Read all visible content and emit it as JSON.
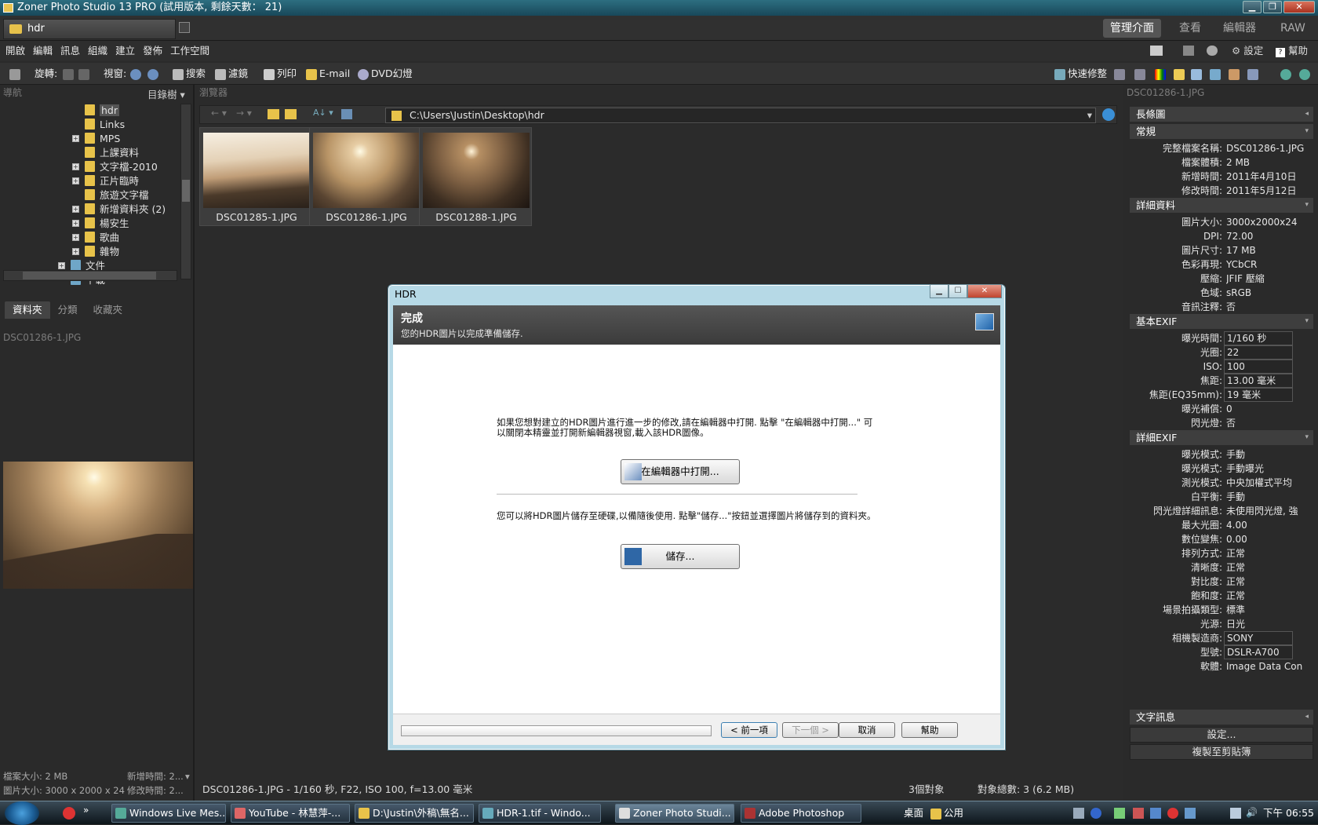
{
  "window": {
    "title": "Zoner Photo Studio 13 PRO (試用版本, 剩餘天數： 21)"
  },
  "doc_tab": "hdr",
  "modes": [
    "管理介面",
    "查看",
    "編輯器",
    "RAW"
  ],
  "menu": [
    "開啟",
    "編輯",
    "訊息",
    "組織",
    "建立",
    "發佈",
    "工作空間"
  ],
  "menu_right": {
    "settings": "設定",
    "help": "幫助"
  },
  "toolbar": {
    "rotate": "旋轉:",
    "view": "視窗:",
    "search": "搜索",
    "filter": "濾鏡",
    "print": "列印",
    "email": "E-mail",
    "dvd": "DVD幻燈",
    "quick_fix": "快速修整"
  },
  "left": {
    "nav_title": "導航",
    "tree_mode": "目錄樹",
    "tabs": [
      "資料夾",
      "分類",
      "收藏夾"
    ],
    "preview_title": "DSC01286-1.JPG",
    "tree": [
      {
        "label": "hdr",
        "plus": false,
        "selected": true
      },
      {
        "label": "Links",
        "plus": false
      },
      {
        "label": "MPS",
        "plus": true
      },
      {
        "label": "上課資料",
        "plus": false
      },
      {
        "label": "文字檔-2010",
        "plus": true
      },
      {
        "label": "正片臨時",
        "plus": true
      },
      {
        "label": "旅遊文字檔",
        "plus": false
      },
      {
        "label": "新增資料夾 (2)",
        "plus": true
      },
      {
        "label": "楊安生",
        "plus": true
      },
      {
        "label": "歌曲",
        "plus": true
      },
      {
        "label": "雜物",
        "plus": true
      },
      {
        "label": "文件",
        "plus": true,
        "level": 0
      },
      {
        "label": "下載",
        "plus": false,
        "level": 0
      }
    ],
    "status": [
      "檔案大小: 2 MB",
      "新增時間: 2...",
      "圖片大小: 3000 x 2000 x 24",
      "修改時間: 2..."
    ]
  },
  "center": {
    "title": "瀏覽器",
    "path": "C:\\Users\\Justin\\Desktop\\hdr",
    "thumbs": [
      "DSC01285-1.JPG",
      "DSC01286-1.JPG",
      "DSC01288-1.JPG"
    ],
    "status_left": "DSC01286-1.JPG - 1/160 秒, F22, ISO 100, f=13.00 毫米",
    "status_count": "3個對象",
    "status_total": "對象總數: 3 (6.2 MB)"
  },
  "right": {
    "title": "DSC01286-1.JPG",
    "sections": {
      "long": "長條圖",
      "general": "常規",
      "details": "詳細資料",
      "basic_exif": "基本EXIF",
      "detail_exif": "詳細EXIF",
      "text_info": "文字訊息"
    },
    "general": [
      [
        "完整檔案名稱:",
        "DSC01286-1.JPG"
      ],
      [
        "檔案體積:",
        "2 MB"
      ],
      [
        "新增時間:",
        "2011年4月10日"
      ],
      [
        "修改時間:",
        "2011年5月12日"
      ]
    ],
    "details": [
      [
        "圖片大小:",
        "3000x2000x24"
      ],
      [
        "DPI:",
        "72.00"
      ],
      [
        "圖片尺寸:",
        "17 MB"
      ],
      [
        "色彩再現:",
        "YCbCR"
      ],
      [
        "壓縮:",
        "JFIF 壓縮"
      ],
      [
        "色域:",
        "sRGB"
      ],
      [
        "音訊注釋:",
        "否"
      ]
    ],
    "basic_exif": [
      [
        "曝光時間:",
        "1/160 秒"
      ],
      [
        "光圈:",
        "22"
      ],
      [
        "ISO:",
        "100"
      ],
      [
        "焦距:",
        "13.00 毫米"
      ],
      [
        "焦距(EQ35mm):",
        "19 毫米"
      ],
      [
        "曝光補償:",
        "0"
      ],
      [
        "閃光燈:",
        "否"
      ]
    ],
    "detail_exif": [
      [
        "曝光模式:",
        "手動"
      ],
      [
        "曝光模式:",
        "手動曝光"
      ],
      [
        "測光模式:",
        "中央加權式平均"
      ],
      [
        "白平衡:",
        "手動"
      ],
      [
        "閃光燈詳細訊息:",
        "未使用閃光燈, 強"
      ],
      [
        "最大光圈:",
        "4.00"
      ],
      [
        "數位變焦:",
        "0.00"
      ],
      [
        "排列方式:",
        "正常"
      ],
      [
        "清晰度:",
        "正常"
      ],
      [
        "對比度:",
        "正常"
      ],
      [
        "飽和度:",
        "正常"
      ],
      [
        "場景拍攝類型:",
        "標準"
      ],
      [
        "光源:",
        "日光"
      ],
      [
        "相機製造商:",
        "SONY"
      ],
      [
        "型號:",
        "DSLR-A700"
      ],
      [
        "軟體:",
        "Image Data Con"
      ]
    ],
    "buttons": [
      "設定...",
      "複製至剪貼簿"
    ]
  },
  "dialog": {
    "title": "HDR",
    "heading": "完成",
    "subheading": "您的HDR圖片以完成準備儲存.",
    "text1a": "如果您想對建立的HDR圖片進行進一步的修改,請在編輯器中打開. 點擊 \"在編輯器中打開...\" 可",
    "text1b": "以關閉本精靈並打開新編輯器視窗,載入該HDR圖像。",
    "open_btn": "在編輯器中打開...",
    "text2": "您可以將HDR圖片儲存至硬碟,以備隨後使用. 點擊\"儲存...\"按鈕並選擇圖片將儲存到的資料夾。",
    "save_btn": "儲存...",
    "prev": "< 前一項",
    "next": "下一個 >",
    "cancel": "取消",
    "help": "幫助"
  },
  "taskbar": {
    "tasks": [
      "Windows Live Mes...",
      "YouTube - 林慧萍-...",
      "D:\\Justin\\外稿\\無名...",
      "HDR-1.tif - Windo...",
      "Zoner Photo Studi...",
      "Adobe Photoshop"
    ],
    "desktop": "桌面",
    "public": "公用",
    "clock": "下午 06:55"
  },
  "colors": {
    "accent": "#2d6e80",
    "folder": "#e8c34a"
  }
}
